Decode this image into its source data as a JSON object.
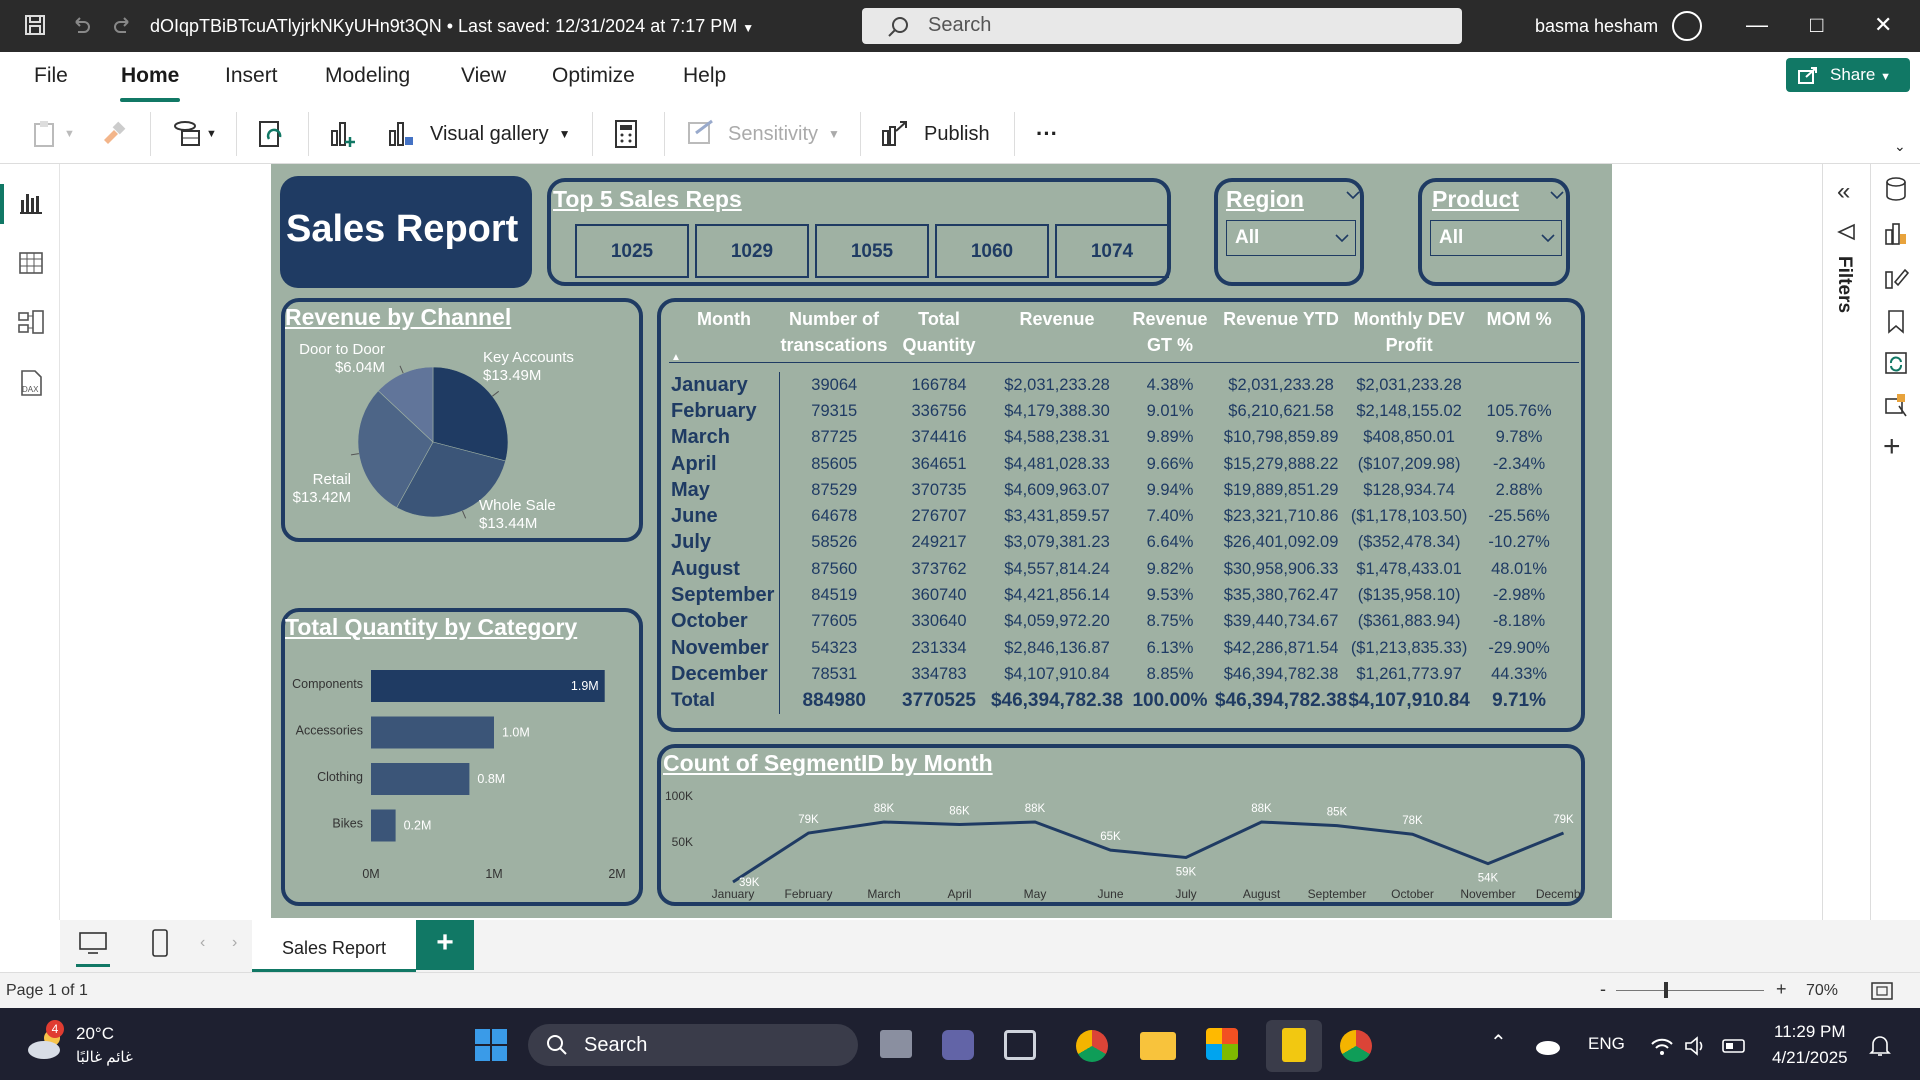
{
  "titlebar": {
    "doc_title": "dOIqpTBiBTcuATlyjrkNKyUHn9t3QN  •  Last saved: 12/31/2024 at 7:17 PM",
    "search_placeholder": "Search",
    "user": "basma hesham"
  },
  "menu": {
    "items": [
      "File",
      "Home",
      "Insert",
      "Modeling",
      "View",
      "Optimize",
      "Help"
    ],
    "share": "Share"
  },
  "toolbar": {
    "visual_gallery": "Visual gallery",
    "sensitivity": "Sensitivity",
    "publish": "Publish",
    "more": "···"
  },
  "report": {
    "title": "Sales Report",
    "top_reps": {
      "title": "Top 5 Sales Reps",
      "reps": [
        "1025",
        "1029",
        "1055",
        "1060",
        "1074"
      ]
    },
    "region": {
      "title": "Region",
      "value": "All"
    },
    "product": {
      "title": "Product",
      "value": "All"
    },
    "revenue_by_channel": {
      "title": "Revenue by Channel"
    },
    "total_qty_by_category": {
      "title": "Total Quantity by Category"
    },
    "count_segment": {
      "title": "Count of SegmentID by Month"
    },
    "matrix": {
      "headers": [
        "Month",
        "Number of transcations",
        "Total Quantity",
        "Revenue",
        "Revenue GT %",
        "Revenue YTD",
        "Monthly DEV Profit",
        "MOM %"
      ],
      "rows": [
        [
          "January",
          "39064",
          "166784",
          "$2,031,233.28",
          "4.38%",
          "$2,031,233.28",
          "$2,031,233.28",
          ""
        ],
        [
          "February",
          "79315",
          "336756",
          "$4,179,388.30",
          "9.01%",
          "$6,210,621.58",
          "$2,148,155.02",
          "105.76%"
        ],
        [
          "March",
          "87725",
          "374416",
          "$4,588,238.31",
          "9.89%",
          "$10,798,859.89",
          "$408,850.01",
          "9.78%"
        ],
        [
          "April",
          "85605",
          "364651",
          "$4,481,028.33",
          "9.66%",
          "$15,279,888.22",
          "($107,209.98)",
          "-2.34%"
        ],
        [
          "May",
          "87529",
          "370735",
          "$4,609,963.07",
          "9.94%",
          "$19,889,851.29",
          "$128,934.74",
          "2.88%"
        ],
        [
          "June",
          "64678",
          "276707",
          "$3,431,859.57",
          "7.40%",
          "$23,321,710.86",
          "($1,178,103.50)",
          "-25.56%"
        ],
        [
          "July",
          "58526",
          "249217",
          "$3,079,381.23",
          "6.64%",
          "$26,401,092.09",
          "($352,478.34)",
          "-10.27%"
        ],
        [
          "August",
          "87560",
          "373762",
          "$4,557,814.24",
          "9.82%",
          "$30,958,906.33",
          "$1,478,433.01",
          "48.01%"
        ],
        [
          "September",
          "84519",
          "360740",
          "$4,421,856.14",
          "9.53%",
          "$35,380,762.47",
          "($135,958.10)",
          "-2.98%"
        ],
        [
          "October",
          "77605",
          "330640",
          "$4,059,972.20",
          "8.75%",
          "$39,440,734.67",
          "($361,883.94)",
          "-8.18%"
        ],
        [
          "November",
          "54323",
          "231334",
          "$2,846,136.87",
          "6.13%",
          "$42,286,871.54",
          "($1,213,835.33)",
          "-29.90%"
        ],
        [
          "December",
          "78531",
          "334783",
          "$4,107,910.84",
          "8.85%",
          "$46,394,782.38",
          "$1,261,773.97",
          "44.33%"
        ]
      ],
      "total": [
        "Total",
        "884980",
        "3770525",
        "$46,394,782.38",
        "100.00%",
        "$46,394,782.38",
        "$4,107,910.84",
        "9.71%"
      ]
    }
  },
  "chart_data": [
    {
      "type": "pie",
      "title": "Revenue by Channel",
      "labels": [
        "Key Accounts",
        "Whole Sale",
        "Retail",
        "Door to Door"
      ],
      "values": [
        13.49,
        13.44,
        13.42,
        6.04
      ],
      "value_labels": [
        "$13.49M",
        "$13.44M",
        "$13.42M",
        "$6.04M"
      ],
      "colors": [
        "#1f3b63",
        "#3b5578",
        "#4d6587",
        "#61759a"
      ]
    },
    {
      "type": "bar",
      "title": "Total Quantity by Category",
      "categories": [
        "Components",
        "Accessories",
        "Clothing",
        "Bikes"
      ],
      "values": [
        1.9,
        1.0,
        0.8,
        0.2
      ],
      "value_labels": [
        "1.9M",
        "1.0M",
        "0.8M",
        "0.2M"
      ],
      "xticks": [
        "0M",
        "1M",
        "2M"
      ],
      "xlim": [
        0,
        2
      ]
    },
    {
      "type": "line",
      "title": "Count of SegmentID by Month",
      "categories": [
        "January",
        "February",
        "March",
        "April",
        "May",
        "June",
        "July",
        "August",
        "September",
        "October",
        "November",
        "December"
      ],
      "values": [
        39,
        79,
        88,
        86,
        88,
        65,
        59,
        88,
        85,
        78,
        54,
        79
      ],
      "value_labels": [
        "39K",
        "79K",
        "88K",
        "86K",
        "88K",
        "65K",
        "59K",
        "88K",
        "85K",
        "78K",
        "54K",
        "79K"
      ],
      "yticks": [
        "100K",
        "50K"
      ]
    }
  ],
  "pages": {
    "tab": "Sales Report",
    "status": "Page 1 of 1",
    "zoom": "70%"
  },
  "taskbar": {
    "weather_temp": "20°C",
    "weather_desc": "غائم غالبًا",
    "search": "Search",
    "lang": "ENG",
    "time": "11:29 PM",
    "date": "4/21/2025"
  }
}
